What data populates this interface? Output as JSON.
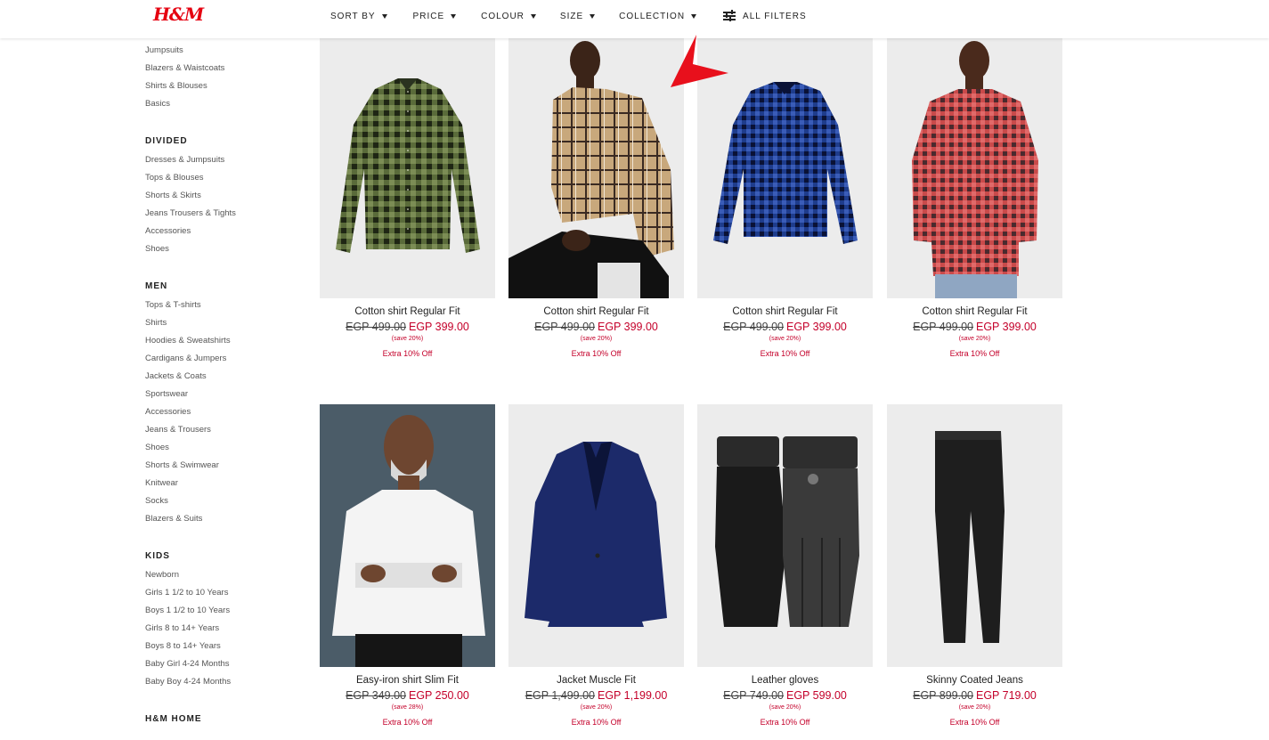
{
  "brand": {
    "logo_text": "H&M",
    "logo_color": "#e50010"
  },
  "filters": {
    "sort_by": "SORT BY",
    "price": "PRICE",
    "colour": "COLOUR",
    "size": "SIZE",
    "collection": "COLLECTION",
    "all_filters": "ALL FILTERS"
  },
  "sidebar": {
    "women_items": [
      "Jumpsuits",
      "Blazers & Waistcoats",
      "Shirts & Blouses",
      "Basics"
    ],
    "divided": {
      "heading": "DIVIDED",
      "items": [
        "Dresses & Jumpsuits",
        "Tops & Blouses",
        "Shorts & Skirts",
        "Jeans Trousers & Tights",
        "Accessories",
        "Shoes"
      ]
    },
    "men": {
      "heading": "MEN",
      "items": [
        "Tops & T-shirts",
        "Shirts",
        "Hoodies & Sweatshirts",
        "Cardigans & Jumpers",
        "Jackets & Coats",
        "Sportswear",
        "Accessories",
        "Jeans & Trousers",
        "Shoes",
        "Shorts & Swimwear",
        "Knitwear",
        "Socks",
        "Blazers & Suits"
      ]
    },
    "kids": {
      "heading": "KIDS",
      "items": [
        "Newborn",
        "Girls 1 1/2 to 10 Years",
        "Boys 1 1/2 to 10 Years",
        "Girls 8 to 14+ Years",
        "Boys 8 to 14+ Years",
        "Baby Girl 4-24 Months",
        "Baby Boy 4-24 Months"
      ]
    },
    "home": {
      "heading": "H&M HOME"
    }
  },
  "products": [
    {
      "name": "Cotton shirt Regular Fit",
      "old_price": "EGP 499.00",
      "new_price": "EGP 399.00",
      "save": "(save 20%)",
      "promo": "Extra 10% Off"
    },
    {
      "name": "Cotton shirt Regular Fit",
      "old_price": "EGP 499.00",
      "new_price": "EGP 399.00",
      "save": "(save 20%)",
      "promo": "Extra 10% Off"
    },
    {
      "name": "Cotton shirt Regular Fit",
      "old_price": "EGP 499.00",
      "new_price": "EGP 399.00",
      "save": "(save 20%)",
      "promo": "Extra 10% Off"
    },
    {
      "name": "Cotton shirt Regular Fit",
      "old_price": "EGP 499.00",
      "new_price": "EGP 399.00",
      "save": "(save 20%)",
      "promo": "Extra 10% Off"
    },
    {
      "name": "Easy-iron shirt Slim Fit",
      "old_price": "EGP 349.00",
      "new_price": "EGP 250.00",
      "save": "(save 28%)",
      "promo": "Extra 10% Off"
    },
    {
      "name": "Jacket Muscle Fit",
      "old_price": "EGP 1,499.00",
      "new_price": "EGP 1,199.00",
      "save": "(save 20%)",
      "promo": "Extra 10% Off"
    },
    {
      "name": "Leather gloves",
      "old_price": "EGP 749.00",
      "new_price": "EGP 599.00",
      "save": "(save 20%)",
      "promo": "Extra 10% Off"
    },
    {
      "name": "Skinny Coated Jeans",
      "old_price": "EGP 899.00",
      "new_price": "EGP 719.00",
      "save": "(save 20%)",
      "promo": "Extra 10% Off"
    }
  ],
  "colors": {
    "sale_red": "#c4002a",
    "image_bg": "#ececec",
    "annotation_arrow": "#e8101c"
  }
}
